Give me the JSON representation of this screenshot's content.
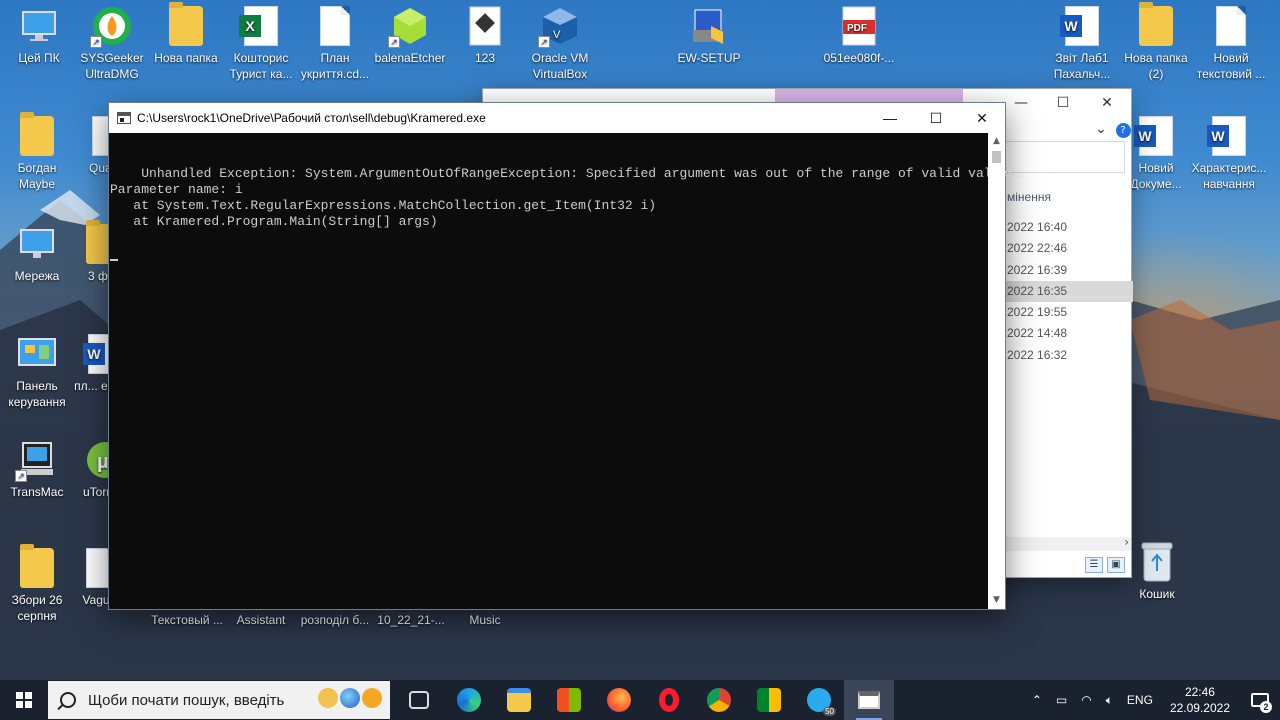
{
  "desktop": {
    "icons": [
      {
        "label": "Цей ПК"
      },
      {
        "label": "SYSGeeker UltraDMG"
      },
      {
        "label": "Нова папка"
      },
      {
        "label": "Кошторис Турист ка..."
      },
      {
        "label": "План укриття.cd..."
      },
      {
        "label": "balenaEtcher"
      },
      {
        "label": "123"
      },
      {
        "label": "Oracle VM VirtualBox"
      },
      {
        "label": "EW-SETUP"
      },
      {
        "label": "051ee080f-..."
      },
      {
        "label": "Звіт Лаб1 Пахальч..."
      },
      {
        "label": "Нова папка (2)"
      },
      {
        "label": "Новий текстовий ..."
      },
      {
        "label": "Богдан Maybe"
      },
      {
        "label": "Quar..."
      },
      {
        "label": "Новий Докуме..."
      },
      {
        "label": "Характерис... навчання"
      },
      {
        "label": "Мережа"
      },
      {
        "label": "3 ф..."
      },
      {
        "label": "Панель керування"
      },
      {
        "label": "пл... евак..."
      },
      {
        "label": "TransMac"
      },
      {
        "label": "uTorre..."
      },
      {
        "label": "Збори 26 серпня"
      },
      {
        "label": "Vagu..."
      },
      {
        "label": "Кошик"
      }
    ],
    "bottom_labels": [
      "Текстовый ...",
      "Assistant",
      "розподіл б...",
      "10_22_21-...",
      "Music"
    ]
  },
  "explorer": {
    "column_header": "мінення",
    "dates": [
      "2022 16:40",
      "2022 22:46",
      "2022 16:39",
      "2022 16:35",
      "2022 19:55",
      "2022 14:48",
      "2022 16:32"
    ],
    "selected_index": 3
  },
  "console": {
    "title": "C:\\Users\\rock1\\OneDrive\\Рабочий стол\\sell\\debug\\Kramered.exe",
    "output": "Unhandled Exception: System.ArgumentOutOfRangeException: Specified argument was out of the range of valid values.\nParameter name: i\n   at System.Text.RegularExpressions.MatchCollection.get_Item(Int32 i)\n   at Kramered.Program.Main(String[] args)"
  },
  "taskbar": {
    "search_placeholder": "Щоби почати пошук, введіть",
    "language": "ENG",
    "time": "22:46",
    "date": "22.09.2022",
    "notification_count": "2",
    "telegram_badge": "50"
  },
  "colors": {
    "console_bg": "#0c0c0c",
    "console_text": "#cccccc",
    "taskbar_bg": "#1a2230"
  }
}
